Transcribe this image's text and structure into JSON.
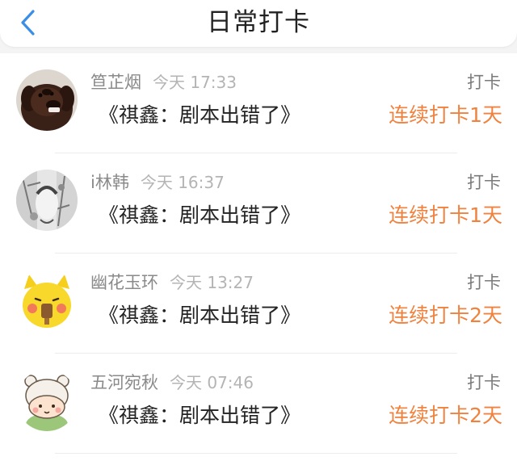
{
  "header": {
    "title": "日常打卡",
    "back_icon": "chevron-left-icon",
    "accent_color": "#3a8ee6"
  },
  "checkin_list": {
    "streak_color": "#f0823e",
    "items": [
      {
        "user": "笪芷烟",
        "time": "今天 17:33",
        "content": "《祺鑫：剧本出错了》",
        "action": "打卡",
        "streak": "连续打卡1天",
        "avatar": "dog-avatar"
      },
      {
        "user": "i林韩",
        "time": "今天 16:37",
        "content": "《祺鑫：剧本出错了》",
        "action": "打卡",
        "streak": "连续打卡1天",
        "avatar": "sketch-avatar"
      },
      {
        "user": "幽花玉环",
        "time": "今天 13:27",
        "content": "《祺鑫：剧本出错了》",
        "action": "打卡",
        "streak": "连续打卡2天",
        "avatar": "yellow-cartoon-avatar"
      },
      {
        "user": "五河宛秋",
        "time": "今天 07:46",
        "content": "《祺鑫：剧本出错了》",
        "action": "打卡",
        "streak": "连续打卡2天",
        "avatar": "bear-cartoon-avatar"
      }
    ]
  }
}
